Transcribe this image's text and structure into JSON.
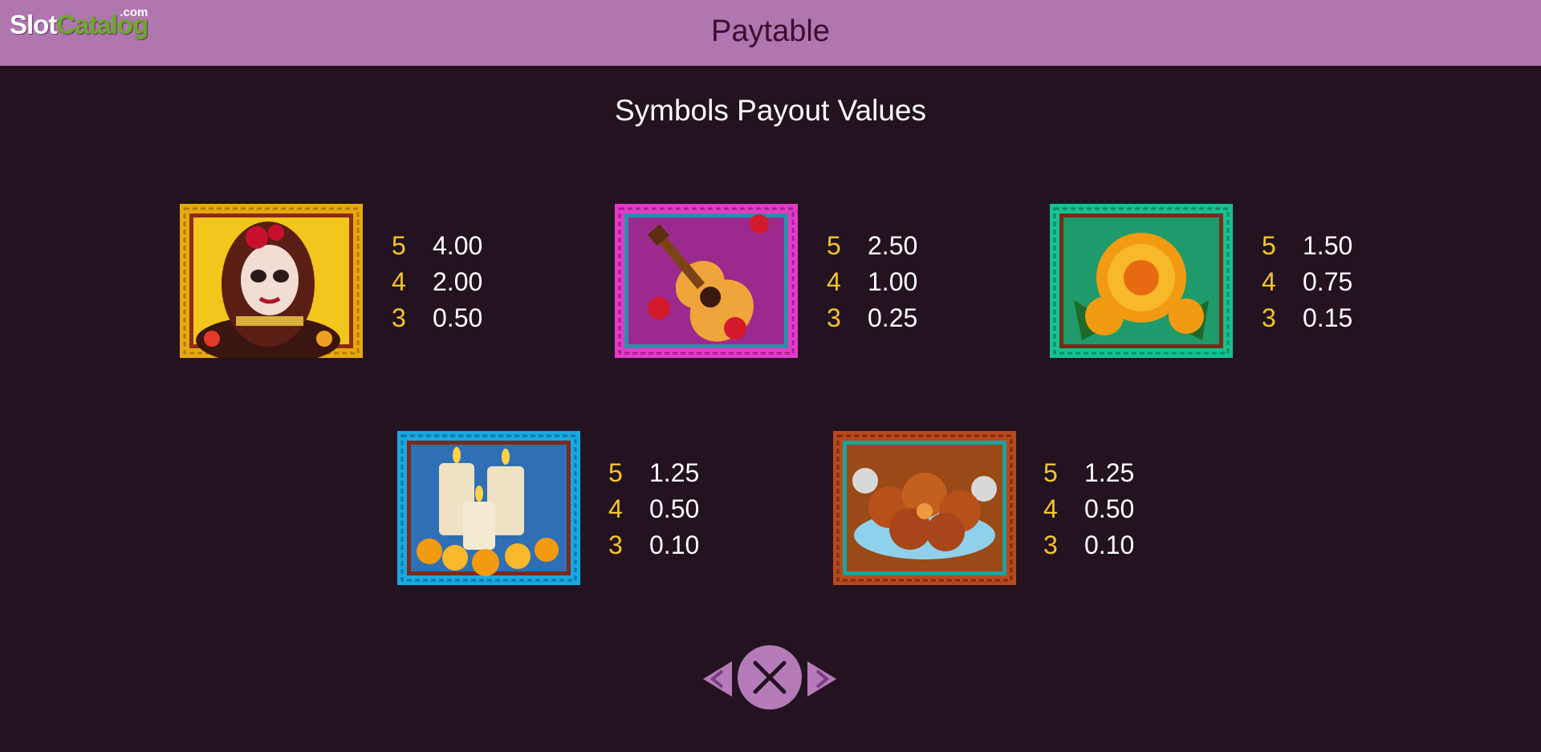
{
  "header": {
    "logo_slot": "Slot",
    "logo_catalog": "Catalog",
    "logo_com": ".com",
    "title": "Paytable"
  },
  "subtitle": "Symbols Payout Values",
  "symbols": [
    {
      "name": "catrina-woman",
      "frame_color": "#e7a90f",
      "pays": [
        {
          "count": "5",
          "value": "4.00"
        },
        {
          "count": "4",
          "value": "2.00"
        },
        {
          "count": "3",
          "value": "0.50"
        }
      ]
    },
    {
      "name": "guitar",
      "frame_color": "#e13bc9",
      "pays": [
        {
          "count": "5",
          "value": "2.50"
        },
        {
          "count": "4",
          "value": "1.00"
        },
        {
          "count": "3",
          "value": "0.25"
        }
      ]
    },
    {
      "name": "marigold",
      "frame_color": "#16c28f",
      "pays": [
        {
          "count": "5",
          "value": "1.50"
        },
        {
          "count": "4",
          "value": "0.75"
        },
        {
          "count": "3",
          "value": "0.15"
        }
      ]
    },
    {
      "name": "candles",
      "frame_color": "#19a8e0",
      "pays": [
        {
          "count": "5",
          "value": "1.25"
        },
        {
          "count": "4",
          "value": "0.50"
        },
        {
          "count": "3",
          "value": "0.10"
        }
      ]
    },
    {
      "name": "bread",
      "frame_color": "#b7491d",
      "pays": [
        {
          "count": "5",
          "value": "1.25"
        },
        {
          "count": "4",
          "value": "0.50"
        },
        {
          "count": "3",
          "value": "0.10"
        }
      ]
    }
  ],
  "nav": {
    "prev_icon": "chevron-left-icon",
    "close_icon": "close-icon",
    "next_icon": "chevron-right-icon"
  }
}
